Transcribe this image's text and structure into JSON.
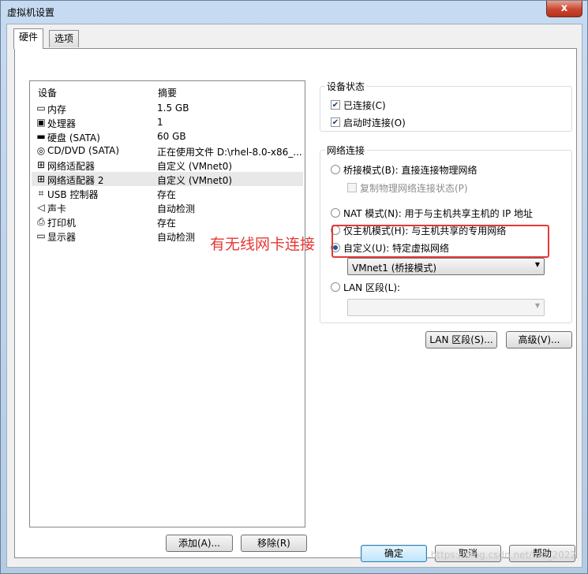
{
  "window": {
    "title": "虚拟机设置",
    "close_glyph": "x"
  },
  "tabs": [
    {
      "label": "硬件",
      "active": true
    },
    {
      "label": "选项",
      "active": false
    }
  ],
  "device_list": {
    "columns": {
      "device": "设备",
      "summary": "摘要"
    },
    "rows": [
      {
        "icon": "memory-icon",
        "name": "内存",
        "summary": "1.5 GB"
      },
      {
        "icon": "cpu-icon",
        "name": "处理器",
        "summary": "1"
      },
      {
        "icon": "harddisk-icon",
        "name": "硬盘 (SATA)",
        "summary": "60 GB"
      },
      {
        "icon": "cd-icon",
        "name": "CD/DVD (SATA)",
        "summary": "正在使用文件 D:\\rhel-8.0-x86_..."
      },
      {
        "icon": "network-icon",
        "name": "网络适配器",
        "summary": "自定义 (VMnet0)"
      },
      {
        "icon": "network-icon",
        "name": "网络适配器 2",
        "summary": "自定义 (VMnet0)",
        "selected": true
      },
      {
        "icon": "usb-icon",
        "name": "USB 控制器",
        "summary": "存在"
      },
      {
        "icon": "speaker-icon",
        "name": "声卡",
        "summary": "自动检测"
      },
      {
        "icon": "printer-icon",
        "name": "打印机",
        "summary": "存在"
      },
      {
        "icon": "monitor-icon",
        "name": "显示器",
        "summary": "自动检测"
      }
    ],
    "add_button": "添加(A)...",
    "remove_button": "移除(R)"
  },
  "device_status": {
    "title": "设备状态",
    "connected": {
      "label": "已连接(C)",
      "checked": true
    },
    "connect_at_power_on": {
      "label": "启动时连接(O)",
      "checked": true
    }
  },
  "network_connection": {
    "title": "网络连接",
    "bridged": {
      "label": "桥接模式(B): 直接连接物理网络",
      "checked": false
    },
    "replicate": {
      "label": "复制物理网络连接状态(P)",
      "checked": false
    },
    "nat": {
      "label": "NAT 模式(N): 用于与主机共享主机的 IP 地址",
      "checked": false
    },
    "host_only": {
      "label": "仅主机模式(H): 与主机共享的专用网络",
      "checked": false
    },
    "custom": {
      "label": "自定义(U): 特定虚拟网络",
      "checked": true
    },
    "custom_select": "VMnet1 (桥接模式)",
    "lan_segment": {
      "label": "LAN 区段(L):",
      "checked": false
    },
    "lan_select": ""
  },
  "actions": {
    "lan_segments_button": "LAN 区段(S)...",
    "advanced_button": "高级(V)..."
  },
  "footer": {
    "ok": "确定",
    "cancel": "取消",
    "help": "帮助"
  },
  "annotation": {
    "text": "有无线网卡连接",
    "color": "#e53935"
  },
  "watermark": "https://blog.csdn.net/m0_2022"
}
